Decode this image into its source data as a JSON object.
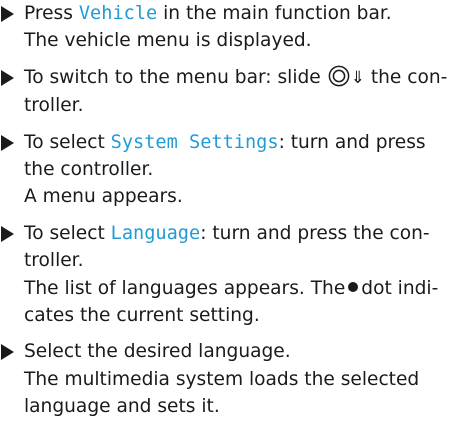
{
  "steps": [
    {
      "lines": [
        {
          "pre": "Press ",
          "menu": "Vehicle",
          "post": " in the main function bar."
        },
        {
          "text": "The vehicle menu is displayed."
        }
      ]
    },
    {
      "line1_pre": "To switch to the menu bar: slide ",
      "line1_arrow": "⇓",
      "line1_post": " the con-",
      "line2": "troller.",
      "icon": "controller-slide-down-icon"
    },
    {
      "line1_pre": "To select ",
      "line1_menu": "System Settings",
      "line1_post": ": turn and press",
      "line2": "the controller.",
      "line3": "A menu appears."
    },
    {
      "line1_pre": "To select ",
      "line1_menu": "Language",
      "line1_post": ": turn and press the con-",
      "line2": "troller.",
      "line3": "The list of languages appears. The",
      "line3_post": "dot indi-",
      "line4": "cates the current setting.",
      "bullet_icon": "filled-dot-icon"
    },
    {
      "line1": "Select the desired language.",
      "line2": "The multimedia system loads the selected",
      "line3": "language and sets it."
    }
  ],
  "colors": {
    "text": "#1a1a1a",
    "menu_label": "#1f9bd6"
  },
  "icons": {
    "bullet": "triangle-right-icon"
  }
}
